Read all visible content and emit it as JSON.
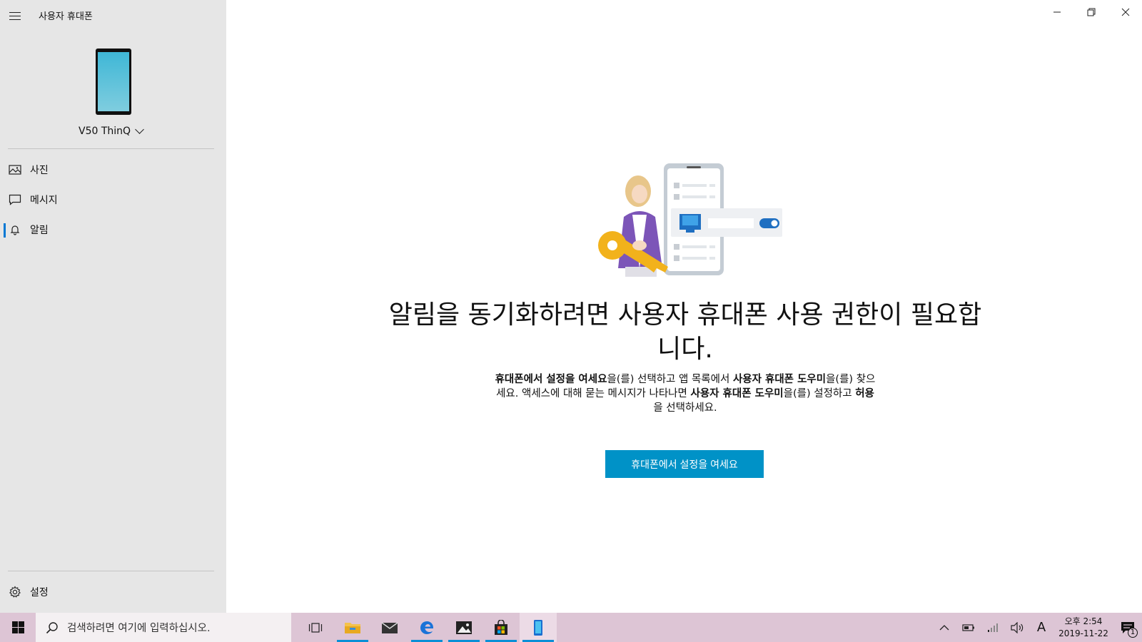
{
  "window": {
    "title": "사용자 휴대폰",
    "minimize_icon": "minimize-icon",
    "restore_icon": "restore-icon",
    "close_icon": "close-icon"
  },
  "sidebar": {
    "device_name": "V50 ThinQ",
    "items": [
      {
        "label": "사진",
        "icon": "photo-icon",
        "active": false
      },
      {
        "label": "메시지",
        "icon": "message-icon",
        "active": false
      },
      {
        "label": "알림",
        "icon": "bell-icon",
        "active": true
      }
    ],
    "settings_label": "설정"
  },
  "main": {
    "headline": "알림을 동기화하려면 사용자 휴대폰 사용 권한이 필요합니다.",
    "instructions": {
      "b1": "휴대폰에서 설정을 여세요",
      "t1": "을(를) 선택하고 앱 목록에서 ",
      "b2": "사용자 휴대폰 도우미",
      "t2": "을(를) 찾으세요. 액세스에 대해 묻는 메시지가 나타나면 ",
      "b3": "사용자 휴대폰 도우미",
      "t3": "을(를) 설정하고 ",
      "b4": "허용",
      "t4": "을 선택하세요."
    },
    "button_label": "휴대폰에서 설정을 여세요"
  },
  "taskbar": {
    "search_placeholder": "검색하려면 여기에 입력하십시오.",
    "apps": [
      "task-view-icon",
      "file-explorer-icon",
      "mail-icon",
      "edge-icon",
      "photos-icon",
      "store-icon",
      "your-phone-icon"
    ],
    "ime_label": "A",
    "clock_time": "오후 2:54",
    "clock_date": "2019-11-22",
    "notification_count": "1",
    "accent": "#0b8fd6"
  },
  "colors": {
    "sidebar_bg": "#e6e6e6",
    "button_bg": "#0092c7",
    "taskbar_bg": "#ddc5d5",
    "active_indicator": "#0078d4"
  }
}
